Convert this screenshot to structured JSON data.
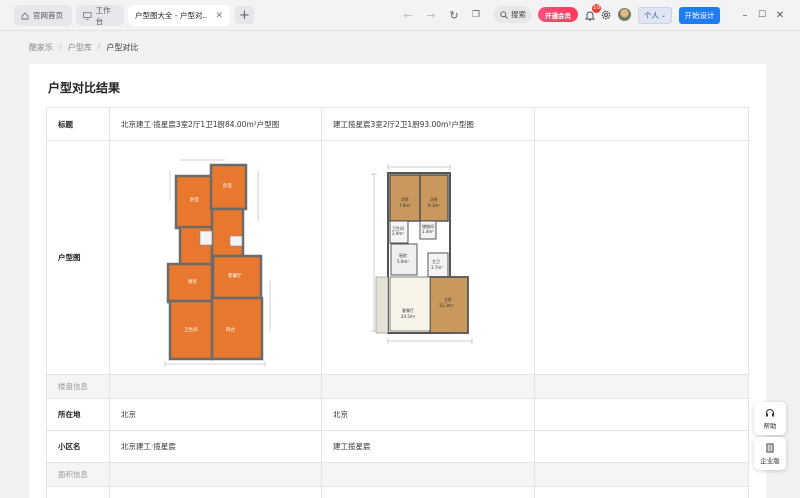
{
  "tabs": [
    {
      "label": "官网首页",
      "icon": "home-icon"
    },
    {
      "label": "工作台",
      "icon": "monitor-icon"
    },
    {
      "label": "户型图大全 - 户型对...",
      "active": true
    }
  ],
  "toolbar": {
    "search_label": "搜索",
    "vip_label": "开通会员",
    "notification_count": "10",
    "personal_label": "个人",
    "start_design_label": "开始设计"
  },
  "breadcrumb": [
    "酷家乐",
    "户型库",
    "户型对比"
  ],
  "page_title": "户型对比结果",
  "table": {
    "title_label": "标题",
    "titles": [
      "北京建工·揽星宸3室2厅1卫1厨84.00m²户型图",
      "建工揽星宸3室2厅2卫1厨93.00m²户型图"
    ],
    "plan_label": "户型图",
    "plan1_rooms": [
      "卧室",
      "卧室",
      "厨房",
      "客餐厅",
      "卫生间",
      "阳台"
    ],
    "plan2_rooms": {
      "r1": "次卧",
      "r1_area": "7.8m²",
      "r2": "次卧",
      "r2_area": "9.1m²",
      "r3": "卫生间",
      "r3_area": "2.9m²",
      "r4": "储物间",
      "r4_area": "1.4m²",
      "r5": "厨房",
      "r5_area": "5.0m²",
      "r6": "主卫",
      "r6_area": "3.7m²",
      "r7": "主卧",
      "r7_area": "12.3m²",
      "r8": "客餐厅",
      "r8_area": "24.5m²"
    },
    "section_building": "楼盘信息",
    "location_label": "所在地",
    "locations": [
      "北京",
      "北京"
    ],
    "community_label": "小区名",
    "communities": [
      "北京建工·揽星宸",
      "建工揽星宸"
    ],
    "section_area": "面积信息"
  },
  "float": {
    "help_label": "帮助",
    "enterprise_label": "企业版"
  },
  "colors": {
    "accent": "#1e7cf2",
    "vip": "#ff3b5c",
    "plan_orange": "#e8782e",
    "plan_wood": "#c9985c"
  }
}
